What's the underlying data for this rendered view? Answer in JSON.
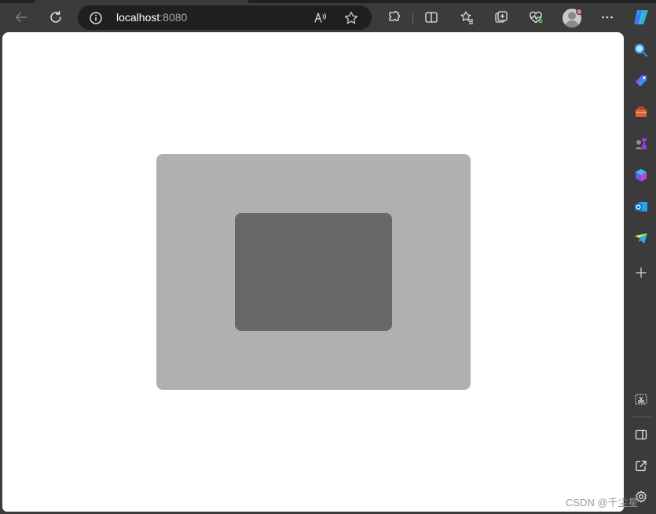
{
  "browser": {
    "address": {
      "host": "localhost",
      "port": ":8080"
    },
    "toolbar_icons": [
      "back-arrow-icon",
      "refresh-icon",
      "info-icon",
      "read-aloud-icon",
      "favorite-star-icon",
      "extensions-icon",
      "split-screen-icon",
      "favorites-icon",
      "collections-icon",
      "browser-essentials-icon",
      "profile-avatar-icon",
      "more-icon",
      "copilot-icon"
    ],
    "sidebar_icons": [
      "search-icon",
      "shopping-icon",
      "tools-icon",
      "games-icon",
      "microsoft-365-icon",
      "outlook-icon",
      "telegram-icon",
      "add-icon",
      "screenshot-icon",
      "sidebar-toggle-icon",
      "open-external-icon",
      "settings-icon"
    ]
  },
  "page": {
    "outer_box_color": "#b0b0b0",
    "inner_box_color": "#6a6866",
    "background_color": "#ffffff"
  },
  "watermark": "CSDN @千尘星"
}
